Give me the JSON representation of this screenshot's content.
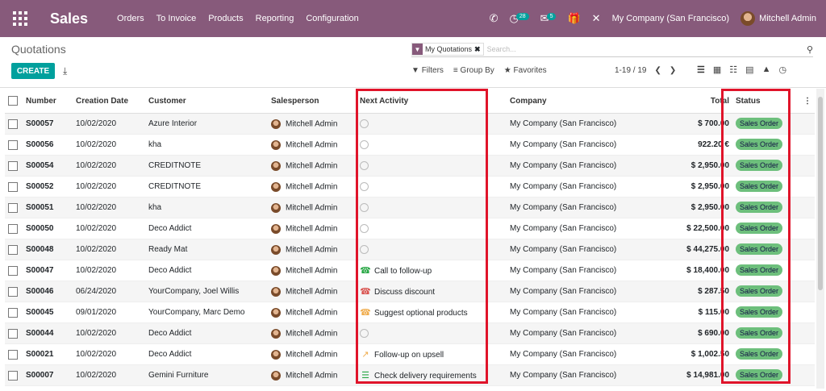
{
  "nav": {
    "brand": "Sales",
    "menu": [
      "Orders",
      "To Invoice",
      "Products",
      "Reporting",
      "Configuration"
    ],
    "activity_count": "28",
    "message_count": "5",
    "company": "My Company (San Francisco)",
    "user": "Mitchell Admin"
  },
  "control": {
    "title": "Quotations",
    "create_label": "CREATE",
    "facet_label": "My Quotations",
    "search_placeholder": "Search...",
    "filters_label": "Filters",
    "groupby_label": "Group By",
    "favorites_label": "Favorites",
    "pager": "1-19 / 19"
  },
  "table": {
    "headers": [
      "Number",
      "Creation Date",
      "Customer",
      "Salesperson",
      "Next Activity",
      "Company",
      "Total",
      "Status"
    ],
    "rows": [
      {
        "number": "S00057",
        "date": "10/02/2020",
        "customer": "Azure Interior",
        "salesperson": "Mitchell Admin",
        "activity": "",
        "activity_icon": "clock-icon",
        "company": "My Company (San Francisco)",
        "total": "$ 700.00",
        "status": "Sales Order"
      },
      {
        "number": "S00056",
        "date": "10/02/2020",
        "customer": "kha",
        "salesperson": "Mitchell Admin",
        "activity": "",
        "activity_icon": "clock-icon",
        "company": "My Company (San Francisco)",
        "total": "922.20 €",
        "status": "Sales Order"
      },
      {
        "number": "S00054",
        "date": "10/02/2020",
        "customer": "CREDITNOTE",
        "salesperson": "Mitchell Admin",
        "activity": "",
        "activity_icon": "clock-icon",
        "company": "My Company (San Francisco)",
        "total": "$ 2,950.00",
        "status": "Sales Order"
      },
      {
        "number": "S00052",
        "date": "10/02/2020",
        "customer": "CREDITNOTE",
        "salesperson": "Mitchell Admin",
        "activity": "",
        "activity_icon": "clock-icon",
        "company": "My Company (San Francisco)",
        "total": "$ 2,950.00",
        "status": "Sales Order"
      },
      {
        "number": "S00051",
        "date": "10/02/2020",
        "customer": "kha",
        "salesperson": "Mitchell Admin",
        "activity": "",
        "activity_icon": "clock-icon",
        "company": "My Company (San Francisco)",
        "total": "$ 2,950.00",
        "status": "Sales Order"
      },
      {
        "number": "S00050",
        "date": "10/02/2020",
        "customer": "Deco Addict",
        "salesperson": "Mitchell Admin",
        "activity": "",
        "activity_icon": "clock-icon",
        "company": "My Company (San Francisco)",
        "total": "$ 22,500.00",
        "status": "Sales Order"
      },
      {
        "number": "S00048",
        "date": "10/02/2020",
        "customer": "Ready Mat",
        "salesperson": "Mitchell Admin",
        "activity": "",
        "activity_icon": "clock-icon",
        "company": "My Company (San Francisco)",
        "total": "$ 44,275.00",
        "status": "Sales Order"
      },
      {
        "number": "S00047",
        "date": "10/02/2020",
        "customer": "Deco Addict",
        "salesperson": "Mitchell Admin",
        "activity": "Call to follow-up",
        "activity_icon": "phone-icon",
        "activity_color": "#28a745",
        "company": "My Company (San Francisco)",
        "total": "$ 18,400.00",
        "status": "Sales Order"
      },
      {
        "number": "S00046",
        "date": "06/24/2020",
        "customer": "YourCompany, Joel Willis",
        "salesperson": "Mitchell Admin",
        "activity": "Discuss discount",
        "activity_icon": "phone-icon",
        "activity_color": "#d9534f",
        "company": "My Company (San Francisco)",
        "total": "$ 287.50",
        "status": "Sales Order"
      },
      {
        "number": "S00045",
        "date": "09/01/2020",
        "customer": "YourCompany, Marc Demo",
        "salesperson": "Mitchell Admin",
        "activity": "Suggest optional products",
        "activity_icon": "phone-icon",
        "activity_color": "#f0ad4e",
        "company": "My Company (San Francisco)",
        "total": "$ 115.00",
        "status": "Sales Order"
      },
      {
        "number": "S00044",
        "date": "10/02/2020",
        "customer": "Deco Addict",
        "salesperson": "Mitchell Admin",
        "activity": "",
        "activity_icon": "clock-icon",
        "company": "My Company (San Francisco)",
        "total": "$ 690.00",
        "status": "Sales Order"
      },
      {
        "number": "S00021",
        "date": "10/02/2020",
        "customer": "Deco Addict",
        "salesperson": "Mitchell Admin",
        "activity": "Follow-up on upsell",
        "activity_icon": "chart-icon",
        "activity_color": "#f0ad4e",
        "company": "My Company (San Francisco)",
        "total": "$ 1,002.50",
        "status": "Sales Order"
      },
      {
        "number": "S00007",
        "date": "10/02/2020",
        "customer": "Gemini Furniture",
        "salesperson": "Mitchell Admin",
        "activity": "Check delivery requirements",
        "activity_icon": "list-icon",
        "activity_color": "#28a745",
        "company": "My Company (San Francisco)",
        "total": "$ 14,981.00",
        "status": "Sales Order"
      }
    ]
  }
}
